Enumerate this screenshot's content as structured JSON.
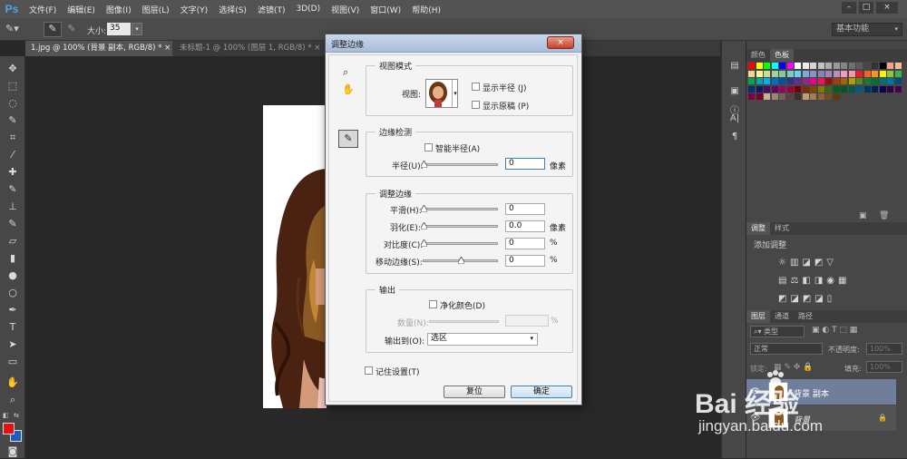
{
  "app": {
    "logo": "Ps"
  },
  "menu": [
    "文件(F)",
    "编辑(E)",
    "图像(I)",
    "图层(L)",
    "文字(Y)",
    "选择(S)",
    "滤镜(T)",
    "3D(D)",
    "视图(V)",
    "窗口(W)",
    "帮助(H)"
  ],
  "window_buttons": [
    "–",
    "□",
    "×"
  ],
  "options": {
    "size_label": "大小:",
    "size_value": "35",
    "workspace": "基本功能"
  },
  "tabs": [
    {
      "label": "1.jpg @ 100% (背景 副本, RGB/8) *",
      "close": "×"
    },
    {
      "label": "未标题-1 @ 100% (图层 1, RGB/8) *",
      "close": "×"
    }
  ],
  "dialog": {
    "title": "调整边缘",
    "close": "×",
    "view_mode": {
      "title": "视图模式",
      "view_label": "视图:",
      "show_radius": "显示半径 (J)",
      "show_original": "显示原稿 (P)"
    },
    "edge_detection": {
      "title": "边缘检测",
      "smart_radius": "智能半径(A)",
      "radius_label": "半径(U):",
      "radius_value": "0",
      "radius_unit": "像素"
    },
    "adjust_edge": {
      "title": "调整边缘",
      "smooth_label": "平滑(H):",
      "smooth_value": "0",
      "feather_label": "羽化(E):",
      "feather_value": "0.0",
      "feather_unit": "像素",
      "contrast_label": "对比度(C):",
      "contrast_value": "0",
      "contrast_unit": "%",
      "shift_label": "移动边缘(S):",
      "shift_value": "0",
      "shift_unit": "%"
    },
    "output": {
      "title": "输出",
      "decontaminate": "净化颜色(D)",
      "amount_label": "数量(N):",
      "amount_unit": "%",
      "output_to_label": "输出到(O):",
      "output_to_value": "选区"
    },
    "remember": "记住设置(T)",
    "reset": "复位",
    "ok": "确定"
  },
  "panels": {
    "color_tabs": [
      "颜色",
      "色板"
    ],
    "adjust_tabs": [
      "调整",
      "样式"
    ],
    "add_adjustment": "添加调整",
    "layer_tabs": [
      "图层",
      "通道",
      "路径"
    ],
    "kind": "类型",
    "blend_mode": "正常",
    "opacity_label": "不透明度:",
    "opacity_value": "100%",
    "lock_label": "锁定:",
    "fill_label": "填充:",
    "fill_value": "100%",
    "layers": [
      {
        "name": "背景 副本"
      },
      {
        "name": "背景"
      }
    ]
  },
  "watermark": {
    "brand": "Bai 经验",
    "url": "jingyan.baidu.com"
  }
}
